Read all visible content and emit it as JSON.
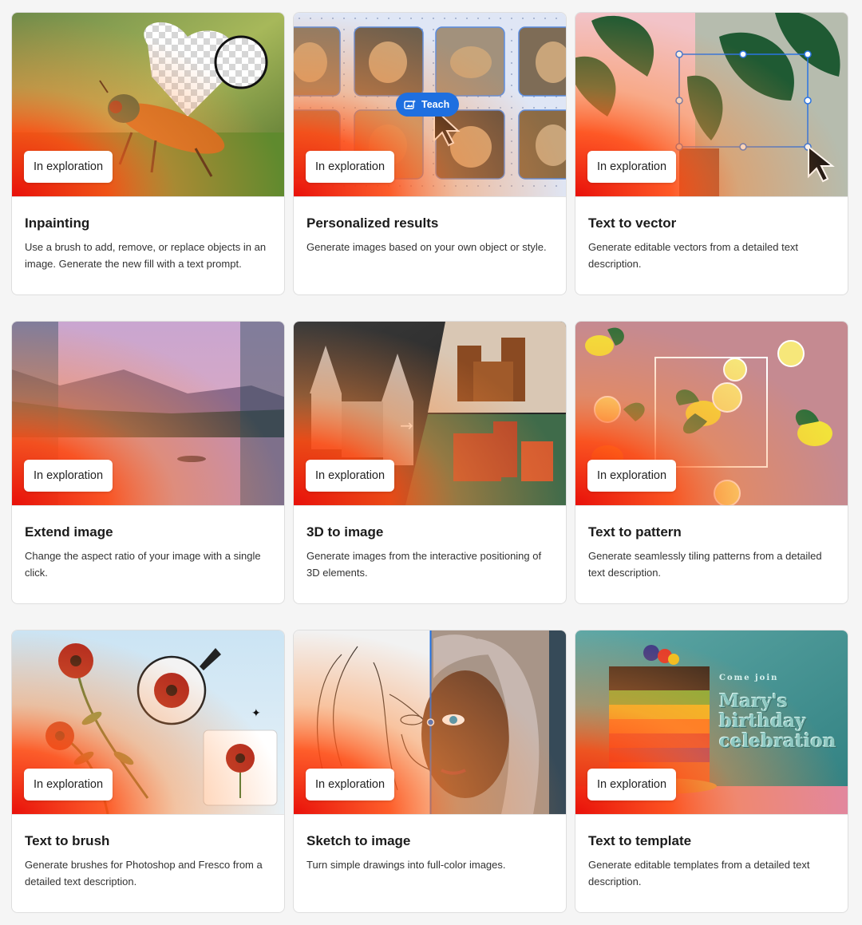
{
  "badge_label": "In exploration",
  "cards": [
    {
      "title": "Inpainting",
      "desc": "Use a brush to add, remove, or replace objects in an image. Generate the new fill with a text prompt."
    },
    {
      "title": "Personalized results",
      "desc": "Generate images based on your own object or style."
    },
    {
      "title": "Text to vector",
      "desc": "Generate editable vectors from a detailed text description."
    },
    {
      "title": "Extend image",
      "desc": "Change the aspect ratio of your image with a single click."
    },
    {
      "title": "3D to image",
      "desc": "Generate images from the interactive positioning of 3D elements."
    },
    {
      "title": "Text to pattern",
      "desc": "Generate seamlessly tiling patterns from a detailed text description."
    },
    {
      "title": "Text to brush",
      "desc": "Generate brushes for Photoshop and Fresco from a detailed text description."
    },
    {
      "title": "Sketch to image",
      "desc": "Turn simple drawings into full-color images."
    },
    {
      "title": "Text to template",
      "desc": "Generate editable templates from a detailed text description."
    }
  ],
  "teach_label": "Teach",
  "template_art": {
    "line1": "Come join",
    "line2": "Mary's",
    "line3": "birthday",
    "line4": "celebration"
  },
  "colors": {
    "accent_blue": "#1e6fe0",
    "gradient_red": "#eb1000",
    "gradient_orange": "#ff7a1a"
  }
}
